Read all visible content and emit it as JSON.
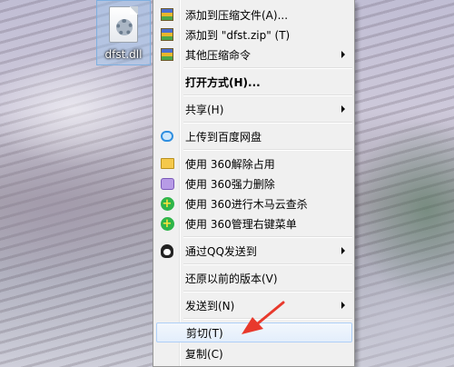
{
  "desktop": {
    "file_name": "dfst.dll"
  },
  "menu": {
    "items": [
      {
        "label": "添加到压缩文件(A)...",
        "icon": "archive-icon",
        "submenu": false,
        "bold": false
      },
      {
        "label": "添加到 \"dfst.zip\" (T)",
        "icon": "archive-icon",
        "submenu": false,
        "bold": false
      },
      {
        "label": "其他压缩命令",
        "icon": "archive-icon",
        "submenu": true,
        "bold": false
      },
      {
        "label": "打开方式(H)...",
        "icon": "",
        "submenu": false,
        "bold": true
      },
      {
        "label": "共享(H)",
        "icon": "",
        "submenu": true,
        "bold": false
      },
      {
        "label": "上传到百度网盘",
        "icon": "cloud-icon",
        "submenu": false,
        "bold": false
      },
      {
        "label": "使用 360解除占用",
        "icon": "unlock-folder-icon",
        "submenu": false,
        "bold": false
      },
      {
        "label": "使用 360强力删除",
        "icon": "shred-icon",
        "submenu": false,
        "bold": false
      },
      {
        "label": "使用 360进行木马云查杀",
        "icon": "360-shield-icon",
        "submenu": false,
        "bold": false
      },
      {
        "label": "使用 360管理右键菜单",
        "icon": "360-shield-icon",
        "submenu": false,
        "bold": false
      },
      {
        "label": "通过QQ发送到",
        "icon": "qq-penguin-icon",
        "submenu": true,
        "bold": false
      },
      {
        "label": "还原以前的版本(V)",
        "icon": "",
        "submenu": false,
        "bold": false
      },
      {
        "label": "发送到(N)",
        "icon": "",
        "submenu": true,
        "bold": false
      },
      {
        "label": "剪切(T)",
        "icon": "",
        "submenu": false,
        "bold": false,
        "highlighted": true
      },
      {
        "label": "复制(C)",
        "icon": "",
        "submenu": false,
        "bold": false
      }
    ]
  },
  "annotation": {
    "arrow_color": "#e8392c"
  }
}
